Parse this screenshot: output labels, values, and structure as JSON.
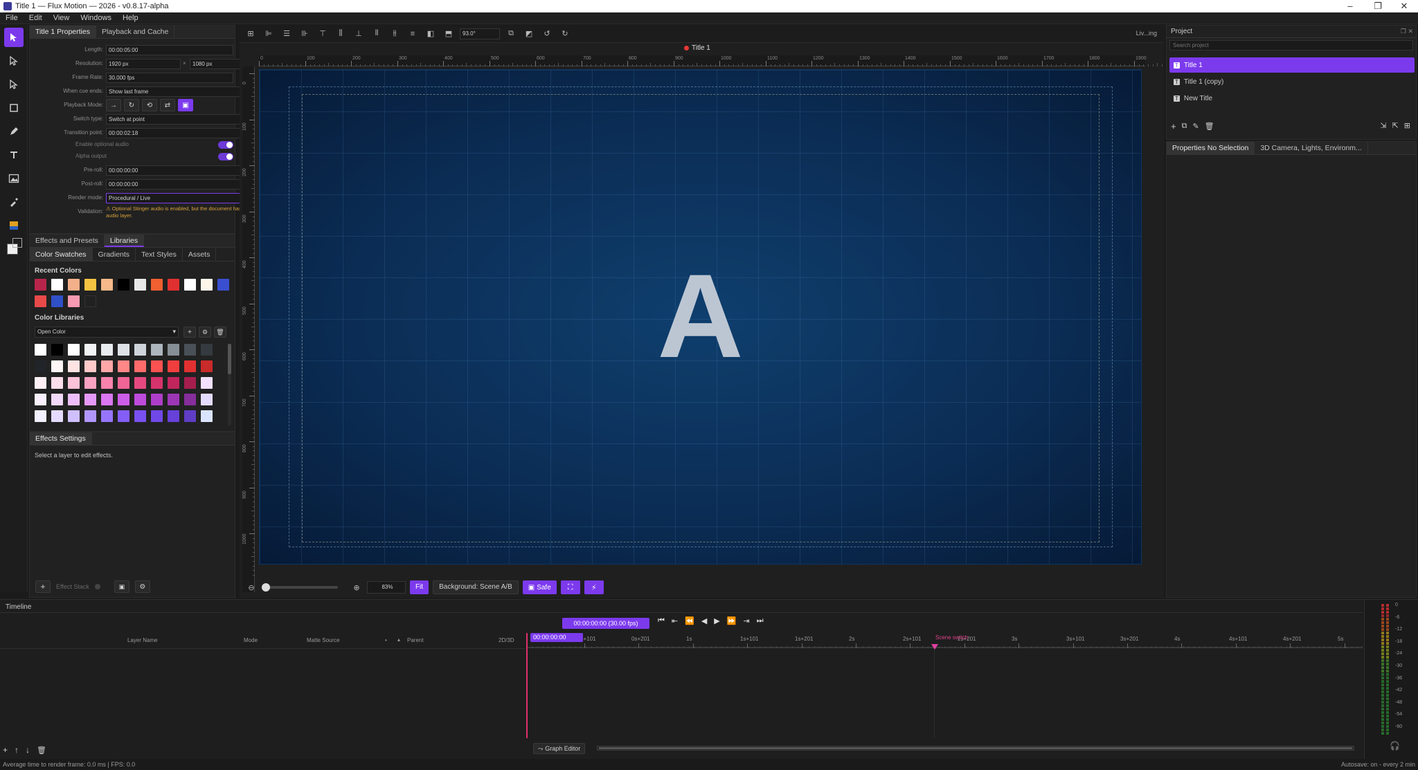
{
  "window": {
    "title": "Title 1 — Flux Motion — 2026 - v0.8.17-alpha"
  },
  "menu": [
    "File",
    "Edit",
    "View",
    "Windows",
    "Help"
  ],
  "left_panel": {
    "tabs": [
      "Title 1 Properties",
      "Playback and Cache"
    ],
    "props": {
      "length_lbl": "Length:",
      "length": "00:00:05:00",
      "res_lbl": "Resolution:",
      "res_w": "1920 px",
      "res_x": "×",
      "res_h": "1080 px",
      "fps_lbl": "Frame Rate:",
      "fps": "30.000 fps",
      "cue_lbl": "When cue ends:",
      "cue": "Show last frame",
      "playback_lbl": "Playback Mode:",
      "switch_lbl": "Switch type:",
      "switch": "Switch at point",
      "trans_lbl": "Transition point:",
      "trans": "00:00:02:18",
      "stinger_lbl": "Enable optional audio",
      "alpha_lbl": "Alpha output",
      "preroll_lbl": "Pre-roll:",
      "preroll": "00:00:00:00",
      "postroll_lbl": "Post-roll:",
      "postroll": "00:00:00:00",
      "render_lbl": "Render mode:",
      "render": "Procedural / Live",
      "valid_lbl": "Validation:",
      "valid_msg": "⚠ Optional Stinger audio is enabled, but the document has no audio layer."
    }
  },
  "libraries": {
    "tabs": [
      "Effects and Presets",
      "Libraries"
    ],
    "subtabs": [
      "Color Swatches",
      "Gradients",
      "Text Styles",
      "Assets"
    ],
    "recent_title": "Recent Colors",
    "recent": [
      "#b8254a",
      "#ffffff",
      "#f3b08a",
      "#f5c242",
      "#f5b98a",
      "#000000",
      "#e8e8e8",
      "#f06030",
      "#e03030",
      "#ffffff",
      "#fff6ea",
      "#3a4fd0",
      "#e84a4a",
      "#3050c8",
      "#f59ab0"
    ],
    "libs_title": "Color Libraries",
    "lib_select": "Open Color",
    "grid": [
      [
        "#ffffff",
        "#000000",
        "#ffffff",
        "#f1f3f5",
        "#e9ecef",
        "#dee2e6",
        "#ced4da",
        "#adb5bd",
        "#868e96",
        "#495057",
        "#343a40"
      ],
      [
        "#212529",
        "#fff5f5",
        "#ffe3e3",
        "#ffc9c9",
        "#ffa8a8",
        "#ff8787",
        "#ff6b6b",
        "#fa5252",
        "#f03e3e",
        "#e03131",
        "#c92a2a"
      ],
      [
        "#fff0f6",
        "#ffdeeb",
        "#fcc2d7",
        "#faa2c1",
        "#f783ac",
        "#f06595",
        "#e64980",
        "#d6336c",
        "#c2255c",
        "#a61e4d",
        "#f3e0ff"
      ],
      [
        "#f8f0fc",
        "#f3d9fa",
        "#eebefa",
        "#e599f7",
        "#da77f2",
        "#cc5de8",
        "#be4bdb",
        "#ae3ec9",
        "#9c36b5",
        "#862e9c",
        "#e5dbff"
      ],
      [
        "#f3f0ff",
        "#e5dbff",
        "#d0bfff",
        "#b197fc",
        "#9775fa",
        "#845ef7",
        "#7950f2",
        "#7048e8",
        "#6741d9",
        "#5f3dc4",
        "#dbe4ff"
      ]
    ]
  },
  "effects_settings": {
    "title": "Effects Settings",
    "msg": "Select a layer to edit effects.",
    "stack": "Effect Stack"
  },
  "canvas": {
    "doc_title": "Title 1",
    "zoom": "93.0°",
    "status_right": "Liv...ing",
    "big_letter": "A",
    "ruler_x": [
      "0",
      "100",
      "200",
      "300",
      "400",
      "500",
      "600",
      "700",
      "800",
      "900",
      "1000",
      "1100",
      "1200",
      "1300",
      "1400",
      "1500",
      "1600",
      "1700",
      "1800",
      "1900"
    ],
    "ruler_y": [
      "0",
      "100",
      "200",
      "300",
      "400",
      "500",
      "600",
      "700",
      "800",
      "900",
      "1000"
    ],
    "bottom": {
      "zoom_pct": "83%",
      "fit": "Fit",
      "bg": "Background: Scene A/B",
      "safe": "Safe"
    }
  },
  "project": {
    "title": "Project",
    "search_ph": "Search project",
    "items": [
      "Title 1",
      "Title 1 (copy)",
      "New Title"
    ],
    "tabs": [
      "Properties No Selection",
      "3D Camera, Lights, Environm..."
    ]
  },
  "timeline": {
    "title": "Timeline",
    "timecode": "00:00:00:00 (30.00 fps)",
    "playhead": "00:00:00:00",
    "cols": [
      "Layer Name",
      "Mode",
      "Matte Source",
      "Parent",
      "2D/3D"
    ],
    "ticks": [
      "0s+101",
      "0s+201",
      "1s",
      "1s+101",
      "1s+201",
      "2s",
      "2s+101",
      "2s+201",
      "3s",
      "3s+101",
      "3s+201",
      "4s",
      "4s+101",
      "4s+201",
      "5s"
    ],
    "marker": "Scene switch",
    "graph": "Graph Editor",
    "vu": [
      "0",
      "-6",
      "-12",
      "-18",
      "-24",
      "-30",
      "-36",
      "-42",
      "-48",
      "-54",
      "-60"
    ]
  },
  "status": {
    "left": "Average time to render frame: 0.0 ms | FPS: 0.0",
    "right": "Autosave: on - every 2 min"
  }
}
